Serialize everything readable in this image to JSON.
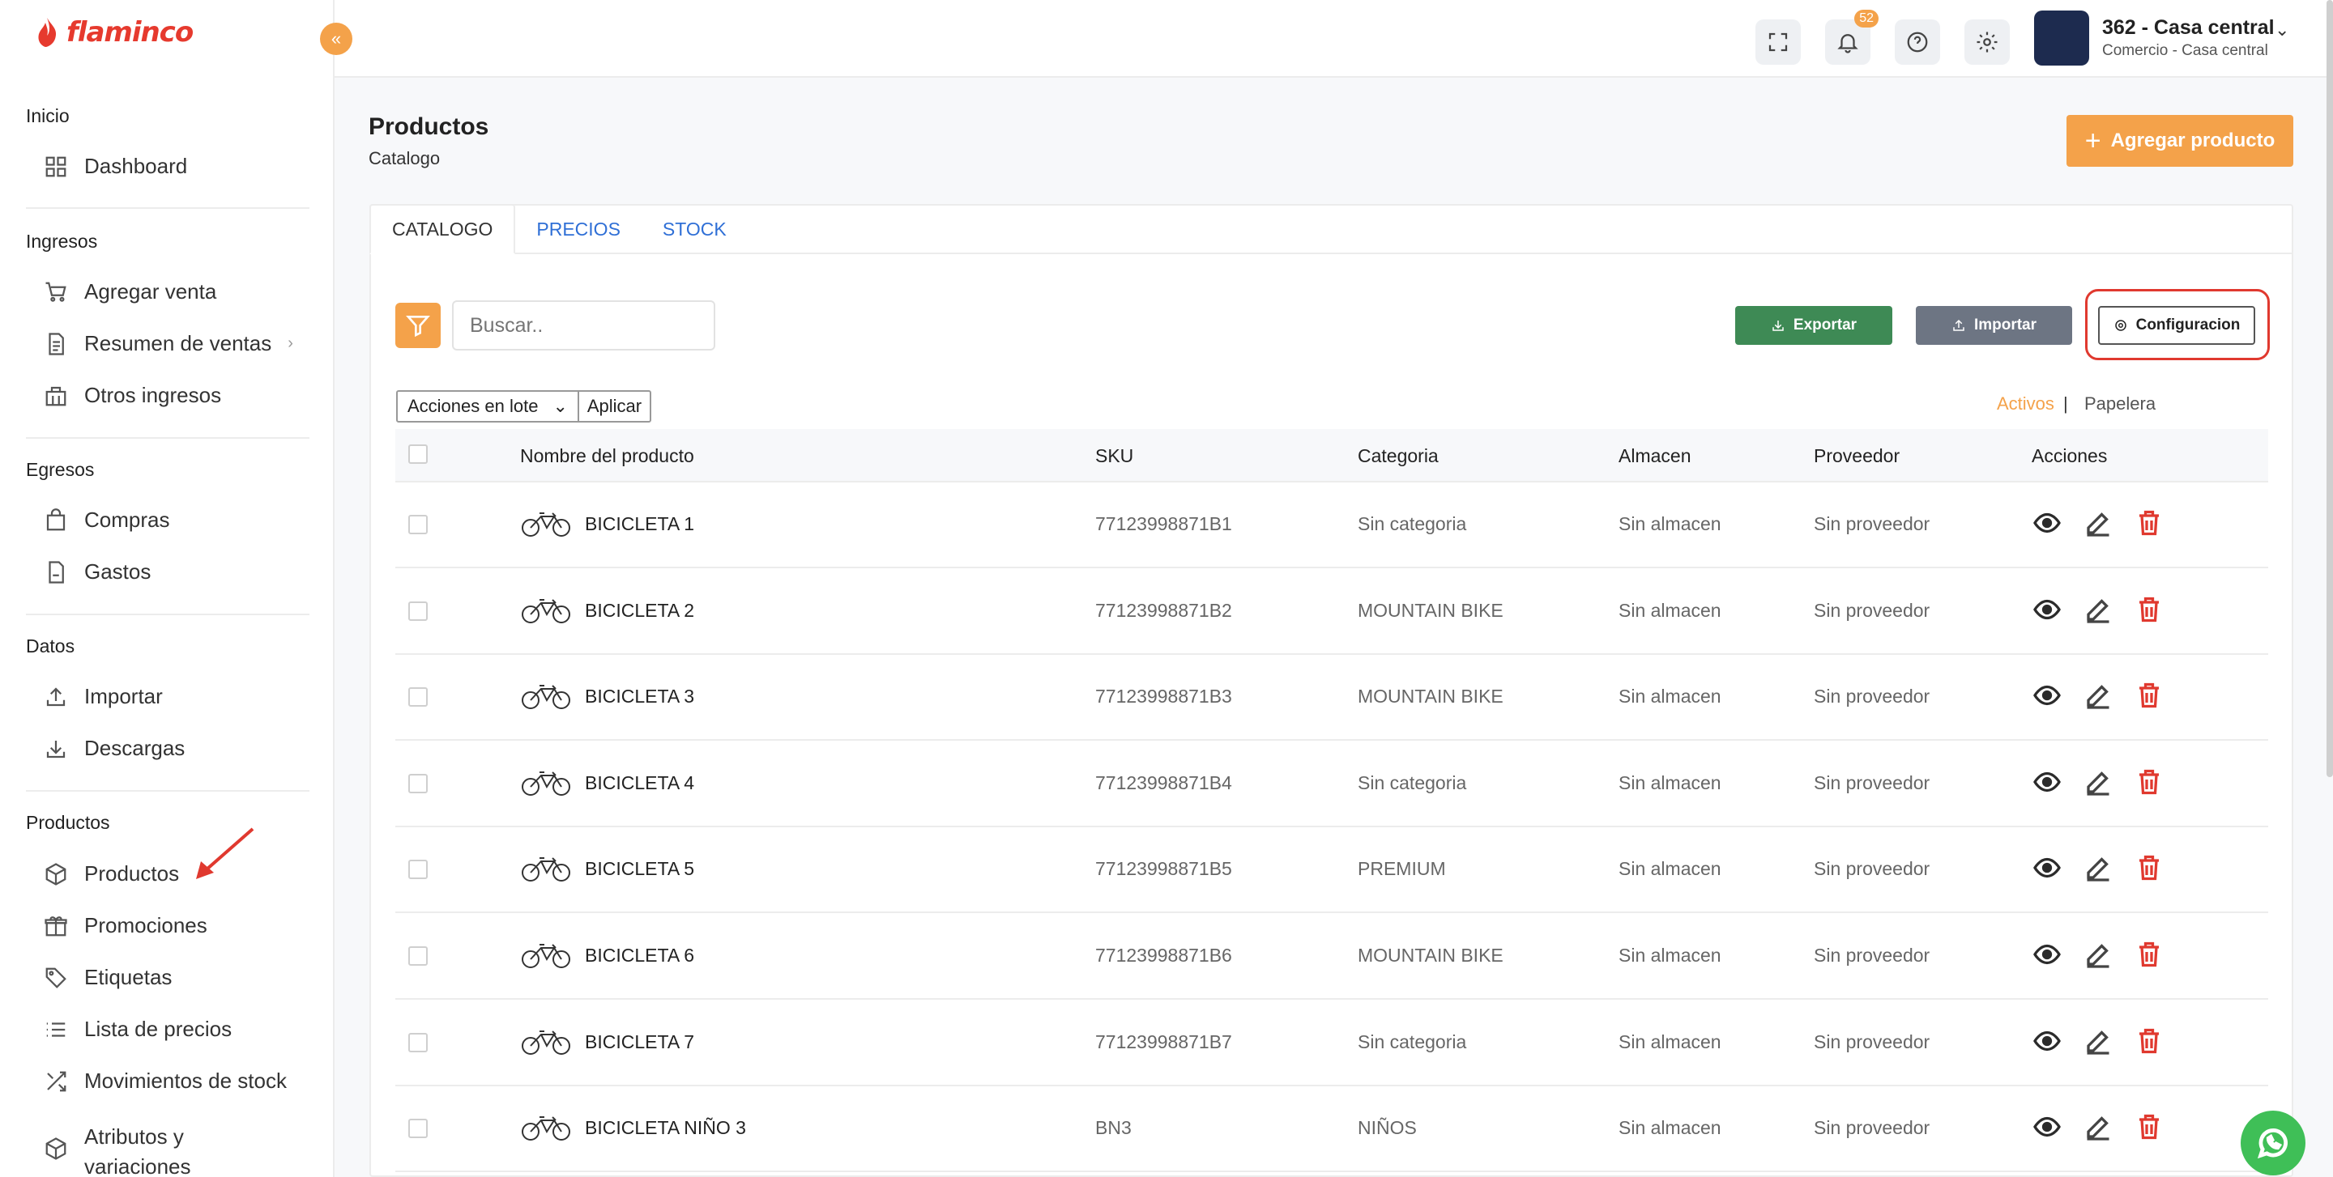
{
  "brand": {
    "name": "flaminco",
    "color": "#e63a2e",
    "accent": "#f4a24a"
  },
  "sidebar": {
    "sections": [
      {
        "title": "Inicio",
        "items": [
          {
            "label": "Dashboard",
            "icon": "grid-icon"
          }
        ]
      },
      {
        "title": "Ingresos",
        "items": [
          {
            "label": "Agregar venta",
            "icon": "cart-icon"
          },
          {
            "label": "Resumen de ventas",
            "icon": "document-icon"
          },
          {
            "label": "Otros ingresos",
            "icon": "building-icon"
          }
        ]
      },
      {
        "title": "Egresos",
        "items": [
          {
            "label": "Compras",
            "icon": "bag-icon"
          },
          {
            "label": "Gastos",
            "icon": "file-icon"
          }
        ]
      },
      {
        "title": "Datos",
        "items": [
          {
            "label": "Importar",
            "icon": "upload-icon"
          },
          {
            "label": "Descargas",
            "icon": "download-icon"
          }
        ]
      },
      {
        "title": "Productos",
        "items": [
          {
            "label": "Productos",
            "icon": "box-icon"
          },
          {
            "label": "Promociones",
            "icon": "gift-icon"
          },
          {
            "label": "Etiquetas",
            "icon": "tag-icon"
          },
          {
            "label": "Lista de precios",
            "icon": "list-icon"
          },
          {
            "label": "Movimientos de stock",
            "icon": "shuffle-icon"
          },
          {
            "label": "Atributos y",
            "label2": "variaciones",
            "icon": "cube-icon"
          }
        ]
      }
    ]
  },
  "header": {
    "notifications_count": "52",
    "store_name": "362 - Casa central",
    "store_sub": "Comercio - Casa central"
  },
  "page": {
    "title": "Productos",
    "subtitle": "Catalogo",
    "add_button": "Agregar producto"
  },
  "tabs": [
    "CATALOGO",
    "PRECIOS",
    "STOCK"
  ],
  "toolbar": {
    "search_placeholder": "Buscar..",
    "export": "Exportar",
    "import": "Importar",
    "config": "Configuracion",
    "bulk_select": "Acciones en lote",
    "apply": "Aplicar",
    "status_active": "Activos",
    "status_sep": "|",
    "status_trash": "Papelera"
  },
  "table": {
    "columns": [
      "Nombre del producto",
      "SKU",
      "Categoria",
      "Almacen",
      "Proveedor",
      "Acciones"
    ],
    "rows": [
      {
        "name": "BICICLETA 1",
        "sku": "77123998871B1",
        "category": "Sin categoria",
        "warehouse": "Sin almacen",
        "supplier": "Sin proveedor"
      },
      {
        "name": "BICICLETA 2",
        "sku": "77123998871B2",
        "category": "MOUNTAIN BIKE",
        "warehouse": "Sin almacen",
        "supplier": "Sin proveedor"
      },
      {
        "name": "BICICLETA 3",
        "sku": "77123998871B3",
        "category": "MOUNTAIN BIKE",
        "warehouse": "Sin almacen",
        "supplier": "Sin proveedor"
      },
      {
        "name": "BICICLETA 4",
        "sku": "77123998871B4",
        "category": "Sin categoria",
        "warehouse": "Sin almacen",
        "supplier": "Sin proveedor"
      },
      {
        "name": "BICICLETA 5",
        "sku": "77123998871B5",
        "category": "PREMIUM",
        "warehouse": "Sin almacen",
        "supplier": "Sin proveedor"
      },
      {
        "name": "BICICLETA 6",
        "sku": "77123998871B6",
        "category": "MOUNTAIN BIKE",
        "warehouse": "Sin almacen",
        "supplier": "Sin proveedor"
      },
      {
        "name": "BICICLETA 7",
        "sku": "77123998871B7",
        "category": "Sin categoria",
        "warehouse": "Sin almacen",
        "supplier": "Sin proveedor"
      },
      {
        "name": "BICICLETA NIÑO 3",
        "sku": "BN3",
        "category": "NIÑOS",
        "warehouse": "Sin almacen",
        "supplier": "Sin proveedor"
      }
    ]
  }
}
